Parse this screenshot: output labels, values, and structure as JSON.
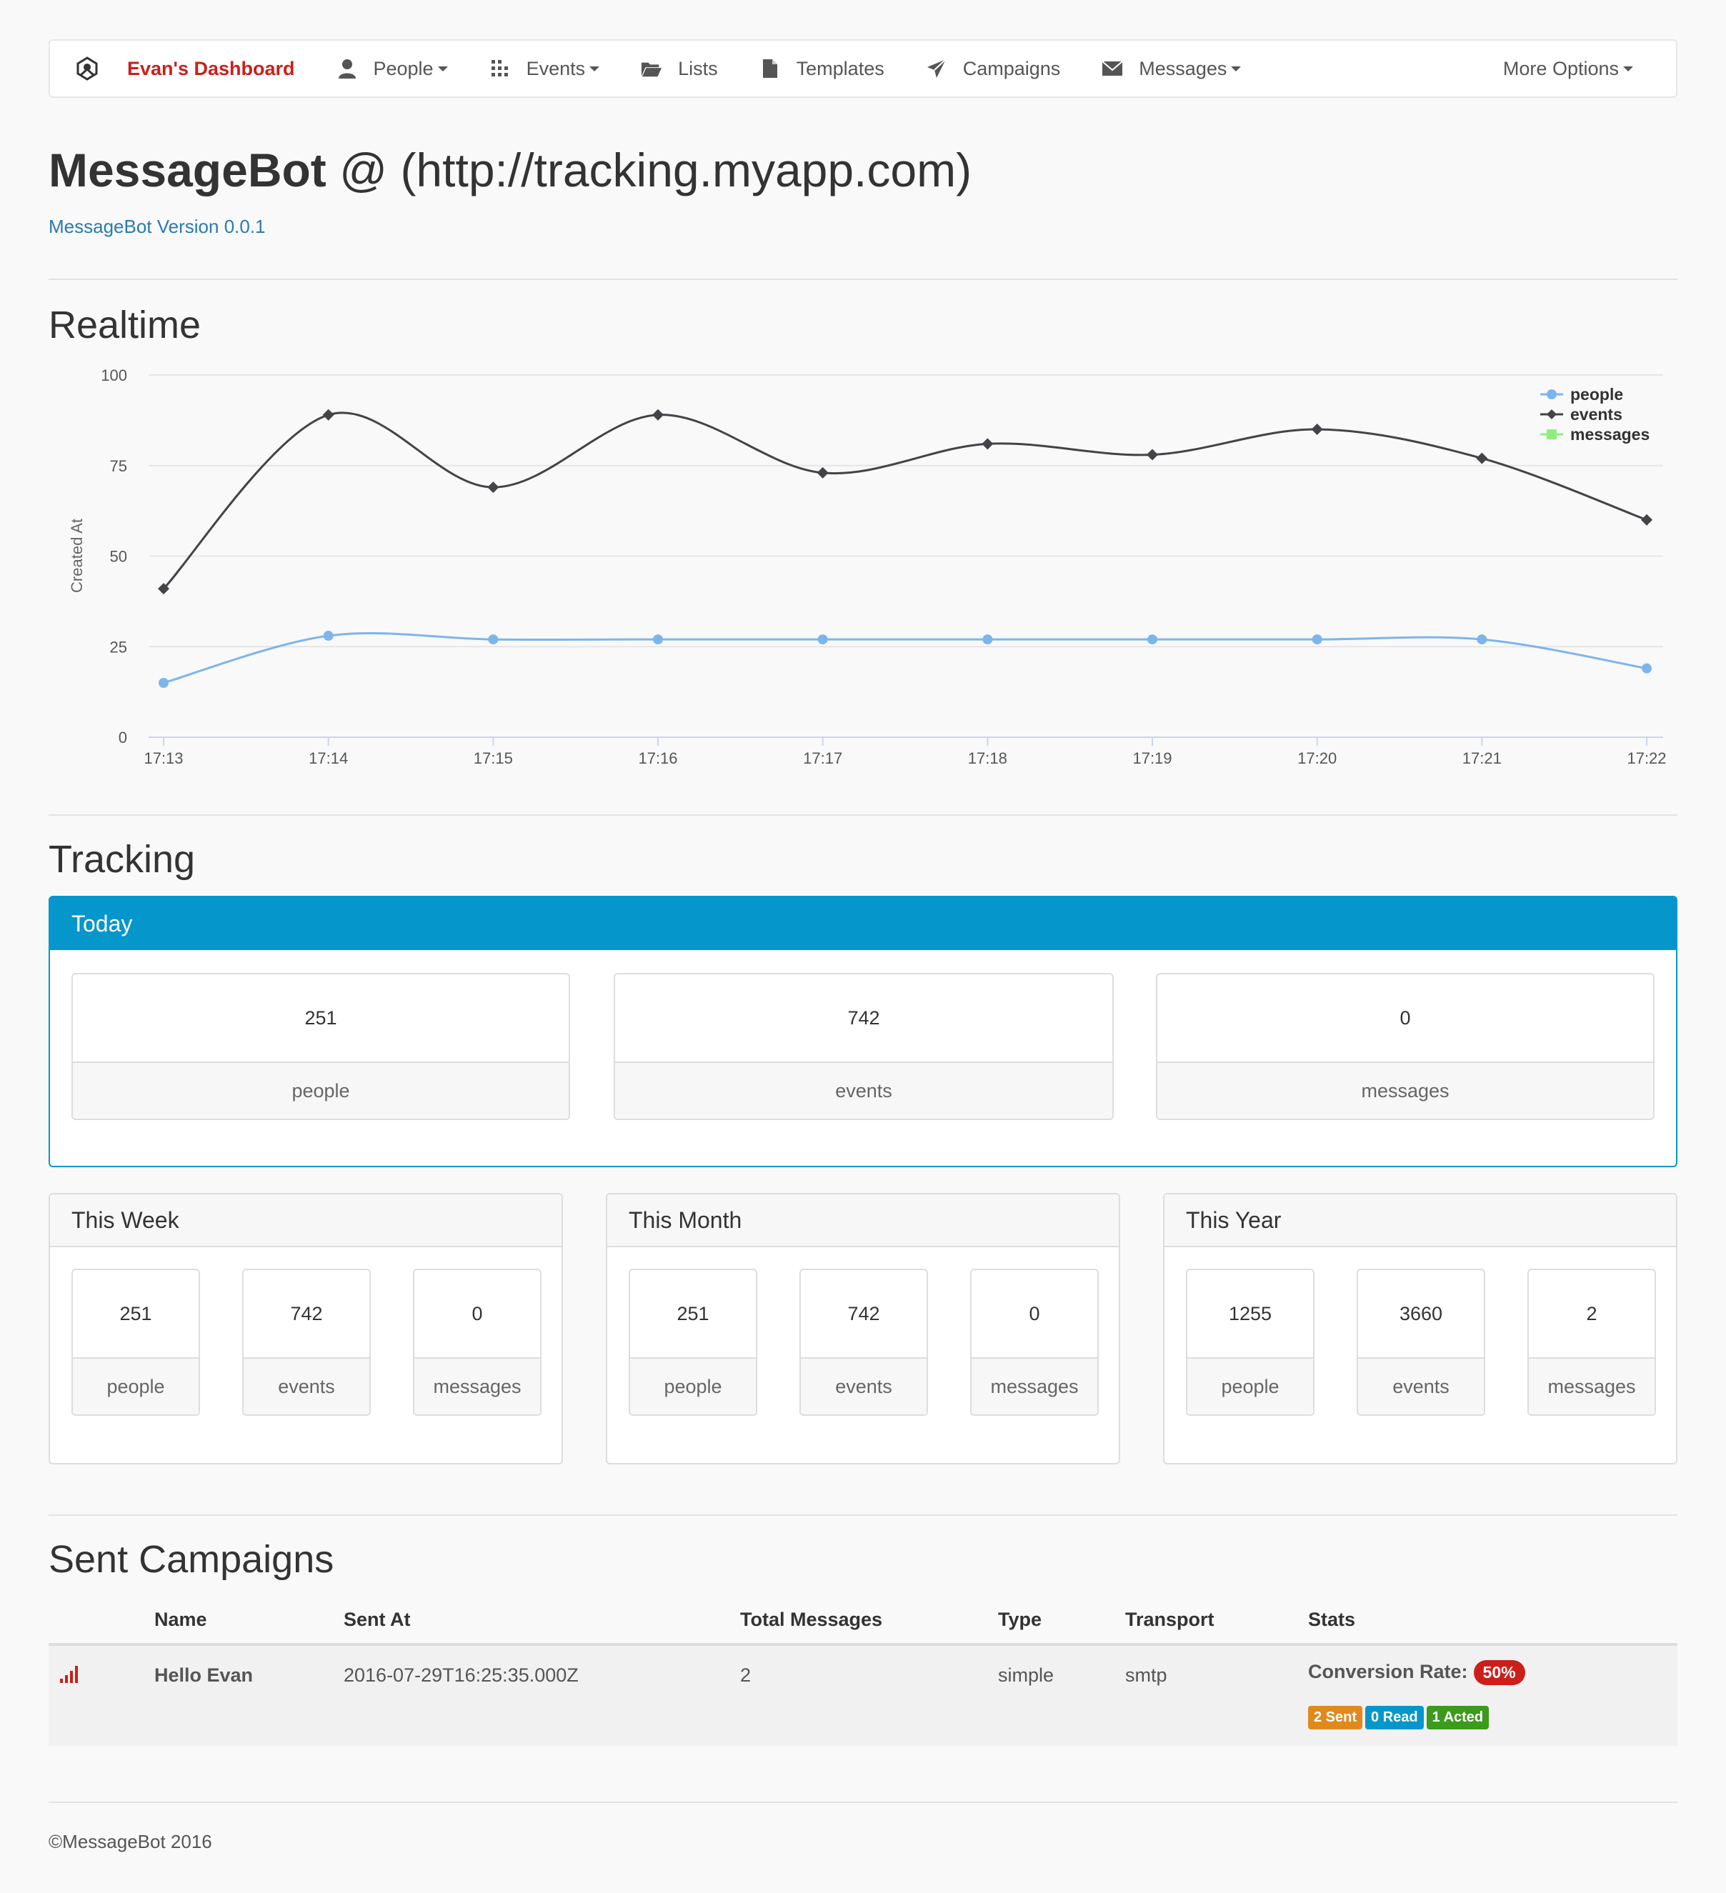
{
  "navbar": {
    "brand": "Evan's Dashboard",
    "items": [
      {
        "label": "People",
        "icon": "user-icon",
        "dropdown": true
      },
      {
        "label": "Events",
        "icon": "grid-icon",
        "dropdown": true
      },
      {
        "label": "Lists",
        "icon": "folder-open-icon",
        "dropdown": false
      },
      {
        "label": "Templates",
        "icon": "file-icon",
        "dropdown": false
      },
      {
        "label": "Campaigns",
        "icon": "send-icon",
        "dropdown": false
      },
      {
        "label": "Messages",
        "icon": "envelope-icon",
        "dropdown": true
      }
    ],
    "more": "More Options"
  },
  "header": {
    "title_bold": "MessageBot",
    "title_rest": " @ (http://tracking.myapp.com)",
    "version": "MessageBot Version 0.0.1"
  },
  "realtime": {
    "heading": "Realtime"
  },
  "chart_data": {
    "type": "line",
    "x": [
      "17:13",
      "17:14",
      "17:15",
      "17:16",
      "17:17",
      "17:18",
      "17:19",
      "17:20",
      "17:21",
      "17:22"
    ],
    "ylabel": "Created At",
    "ylim": [
      0,
      100
    ],
    "yticks": [
      0,
      25,
      50,
      75,
      100
    ],
    "grid": true,
    "legend_position": "top-right",
    "series": [
      {
        "name": "people",
        "color": "#7cb5ec",
        "marker": "circle",
        "values": [
          15,
          28,
          27,
          27,
          27,
          27,
          27,
          27,
          27,
          19
        ]
      },
      {
        "name": "events",
        "color": "#434348",
        "marker": "diamond",
        "values": [
          41,
          89,
          69,
          89,
          73,
          81,
          78,
          85,
          77,
          60
        ]
      },
      {
        "name": "messages",
        "color": "#90ed7d",
        "marker": "square",
        "values": []
      }
    ]
  },
  "tracking": {
    "heading": "Tracking",
    "today": {
      "title": "Today",
      "stats": [
        {
          "value": "251",
          "label": "people"
        },
        {
          "value": "742",
          "label": "events"
        },
        {
          "value": "0",
          "label": "messages"
        }
      ]
    },
    "periods": [
      {
        "title": "This Week",
        "stats": [
          {
            "value": "251",
            "label": "people"
          },
          {
            "value": "742",
            "label": "events"
          },
          {
            "value": "0",
            "label": "messages"
          }
        ]
      },
      {
        "title": "This Month",
        "stats": [
          {
            "value": "251",
            "label": "people"
          },
          {
            "value": "742",
            "label": "events"
          },
          {
            "value": "0",
            "label": "messages"
          }
        ]
      },
      {
        "title": "This Year",
        "stats": [
          {
            "value": "1255",
            "label": "people"
          },
          {
            "value": "3660",
            "label": "events"
          },
          {
            "value": "2",
            "label": "messages"
          }
        ]
      }
    ]
  },
  "campaigns": {
    "heading": "Sent Campaigns",
    "columns": [
      "Name",
      "Sent At",
      "Total Messages",
      "Type",
      "Transport",
      "Stats"
    ],
    "rows": [
      {
        "icon": "signal-icon",
        "name": "Hello Evan",
        "sent_at": "2016-07-29T16:25:35.000Z",
        "total": "2",
        "type": "simple",
        "transport": "smtp",
        "conversion_label": "Conversion Rate:",
        "conversion_value": "50%",
        "badges": [
          {
            "text": "2 Sent",
            "color": "#e08a1e"
          },
          {
            "text": "0 Read",
            "color": "#0597cc"
          },
          {
            "text": "1 Acted",
            "color": "#3c9a1c"
          }
        ]
      }
    ]
  },
  "footer": {
    "text": "©MessageBot 2016"
  },
  "colors": {
    "brand": "#cc1f1a",
    "accent": "#0597cc",
    "link": "#2a7ab0"
  }
}
